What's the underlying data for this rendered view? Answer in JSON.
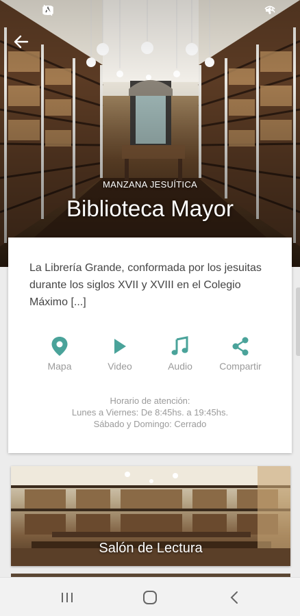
{
  "hero": {
    "subtitle": "MANZANA JESUÍTICA",
    "title": "Biblioteca Mayor"
  },
  "card": {
    "description": "La Librería Grande, conformada por los jesuitas durante los siglos XVII y XVIII en el Colegio Máximo [...]",
    "actions": [
      {
        "label": "Mapa",
        "icon": "map-pin-icon"
      },
      {
        "label": "Video",
        "icon": "play-icon"
      },
      {
        "label": "Audio",
        "icon": "music-note-icon"
      },
      {
        "label": "Compartir",
        "icon": "share-icon"
      }
    ],
    "hours": {
      "line1": "Horario de atención:",
      "line2": "Lunes a Viernes: De 8:45hs. a 19:45hs.",
      "line3": "Sábado y Domingo: Cerrado"
    }
  },
  "rooms": [
    {
      "title": "Salón de Lectura"
    }
  ],
  "colors": {
    "accent": "#4aa39a",
    "muted_text": "#9a9a9a",
    "body_text": "#444444"
  }
}
